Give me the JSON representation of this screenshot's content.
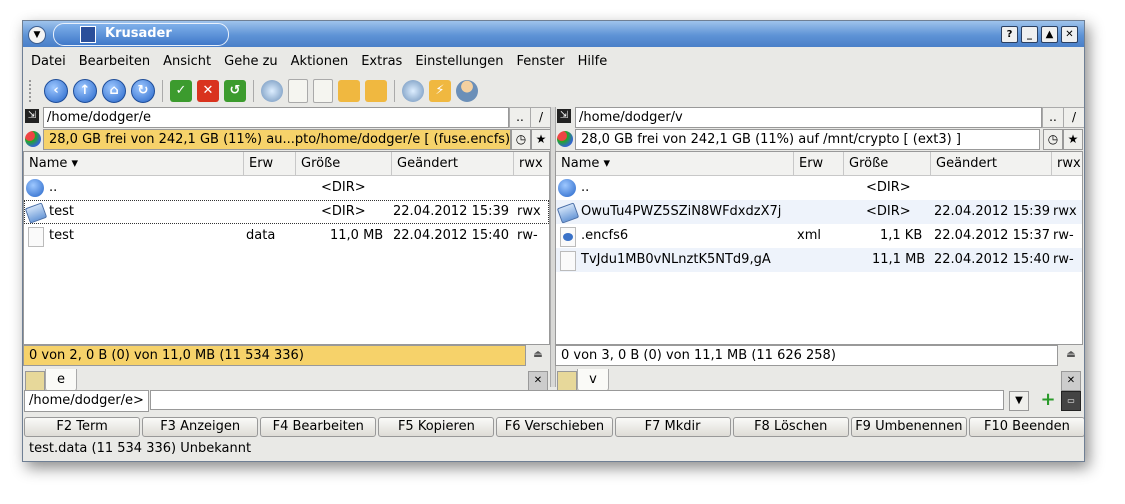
{
  "window": {
    "title": "Krusader"
  },
  "menu": [
    "Datei",
    "Bearbeiten",
    "Ansicht",
    "Gehe zu",
    "Aktionen",
    "Extras",
    "Einstellungen",
    "Fenster",
    "Hilfe"
  ],
  "toolbar": {
    "icons": [
      "back-icon",
      "forward-icon",
      "home-icon",
      "refresh-icon",
      "select-icon",
      "unselect-icon",
      "invert-selection-icon",
      "search-icon",
      "new-file-icon",
      "copy-icon",
      "compare-icon",
      "sync-icon",
      "mount-icon",
      "quick-connect-icon",
      "root-user-icon"
    ]
  },
  "left": {
    "path": "/home/dodger/e",
    "up_btn": "..",
    "root_btn": "/",
    "free": "28,0 GB frei von 242,1 GB (11%) au...pto/home/dodger/e [ (fuse.encfs) ]",
    "columns": [
      "Name",
      "Erw",
      "Größe",
      "Geändert",
      "rwx"
    ],
    "rows": [
      {
        "name": "..",
        "ext": "",
        "size": "<DIR>",
        "date": "",
        "perm": ""
      },
      {
        "name": "test",
        "ext": "",
        "size": "<DIR>",
        "date": "22.04.2012 15:39",
        "perm": "rwx"
      },
      {
        "name": "test",
        "ext": "data",
        "size": "11,0 MB",
        "date": "22.04.2012 15:40",
        "perm": "rw-"
      }
    ],
    "status": "0 von 2, 0 B (0) von 11,0 MB (11 534 336)",
    "tab": "e"
  },
  "right": {
    "path": "/home/dodger/v",
    "up_btn": "..",
    "root_btn": "/",
    "free": "28,0 GB frei von 242,1 GB (11%) auf /mnt/crypto [ (ext3) ]",
    "columns": [
      "Name",
      "Erw",
      "Größe",
      "Geändert",
      "rwx"
    ],
    "rows": [
      {
        "name": "..",
        "ext": "",
        "size": "<DIR>",
        "date": "",
        "perm": ""
      },
      {
        "name": "OwuTu4PWZ5SZiN8WFdxdzX7j",
        "ext": "",
        "size": "<DIR>",
        "date": "22.04.2012 15:39",
        "perm": "rwx"
      },
      {
        "name": ".encfs6",
        "ext": "xml",
        "size": "1,1 KB",
        "date": "22.04.2012 15:37",
        "perm": "rw-"
      },
      {
        "name": "TvJdu1MB0vNLnztK5NTd9,gA",
        "ext": "",
        "size": "11,1 MB",
        "date": "22.04.2012 15:40",
        "perm": "rw-"
      }
    ],
    "status": "0 von 3, 0 B (0) von 11,1 MB (11 626 258)",
    "tab": "v"
  },
  "cmdline": {
    "label": "/home/dodger/e>",
    "value": ""
  },
  "fkeys": [
    "F2 Term",
    "F3 Anzeigen",
    "F4 Bearbeiten",
    "F5 Kopieren",
    "F6 Verschieben",
    "F7 Mkdir",
    "F8 Löschen",
    "F9 Umbenennen",
    "F10 Beenden"
  ],
  "bottom_status": "test.data (11 534 336)  Unbekannt",
  "colors": {
    "active_bar": "#f6d26a",
    "titlebar": "#5e93d6"
  }
}
